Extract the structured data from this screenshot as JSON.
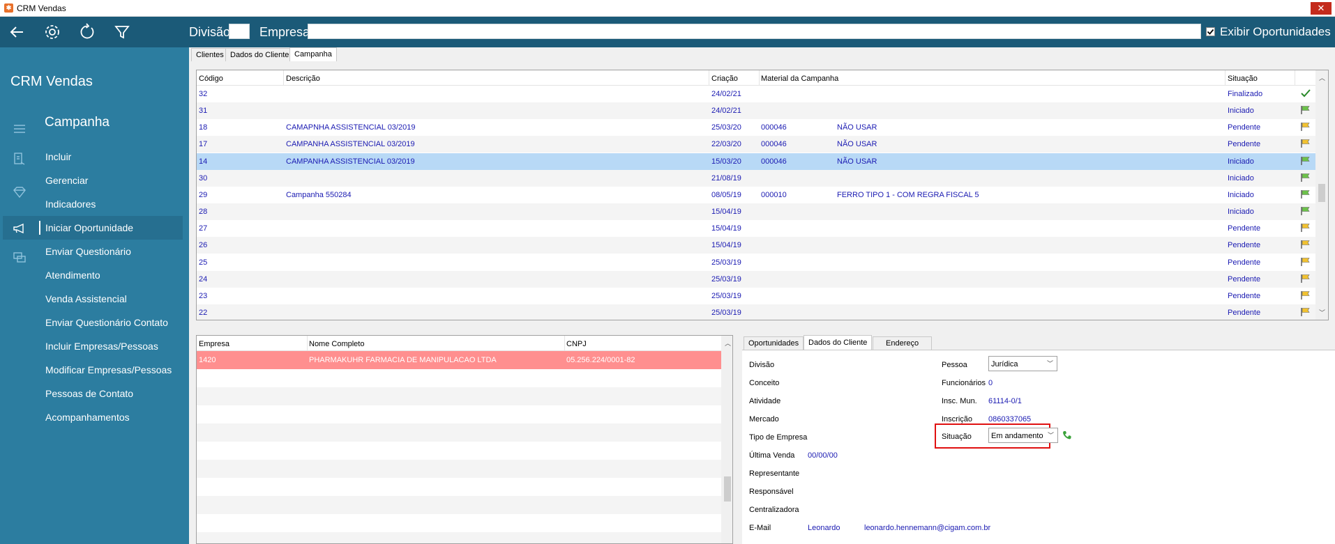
{
  "window": {
    "title": "CRM Vendas",
    "close_glyph": "✕"
  },
  "toolbar": {
    "division_label": "Divisão",
    "division_value": "",
    "company_label": "Empresa",
    "company_value": "",
    "show_opportunities_label": "Exibir Oportunidades",
    "show_opportunities_checked": true,
    "icons": [
      "back-arrow-icon",
      "gear-icon",
      "refresh-icon",
      "filter-icon"
    ]
  },
  "sidebar": {
    "app_title": "CRM Vendas",
    "section": "Campanha",
    "items": [
      {
        "label": "Incluir"
      },
      {
        "label": "Gerenciar"
      },
      {
        "label": "Indicadores"
      },
      {
        "label": "Iniciar Oportunidade",
        "selected": true
      },
      {
        "label": "Enviar Questionário"
      },
      {
        "label": "Atendimento"
      },
      {
        "label": "Venda Assistencial"
      },
      {
        "label": "Enviar Questionário Contato"
      },
      {
        "label": "Incluir Empresas/Pessoas"
      },
      {
        "label": "Modificar Empresas/Pessoas"
      },
      {
        "label": "Pessoas de Contato"
      },
      {
        "label": "Acompanhamentos"
      }
    ]
  },
  "top_tabs": [
    {
      "label": "Clientes",
      "active": false
    },
    {
      "label": "Dados do Cliente",
      "active": false
    },
    {
      "label": "Campanha",
      "active": true
    }
  ],
  "campaign_table": {
    "columns": [
      "Código",
      "Descrição",
      "Criação",
      "Material da Campanha",
      "Situação"
    ],
    "rows": [
      {
        "code": "32",
        "desc": "",
        "created": "24/02/21",
        "mat_code": "",
        "mat_desc": "",
        "status": "Finalizado",
        "icon": "check-icon"
      },
      {
        "code": "31",
        "desc": "",
        "created": "24/02/21",
        "mat_code": "",
        "mat_desc": "",
        "status": "Iniciado",
        "icon": "green-flag-icon"
      },
      {
        "code": "18",
        "desc": "CAMAPNHA ASSISTENCIAL 03/2019",
        "created": "25/03/20",
        "mat_code": "000046",
        "mat_desc": "NÃO USAR",
        "status": "Pendente",
        "icon": "yellow-flag-icon"
      },
      {
        "code": "17",
        "desc": "CAMPANHA ASSISTENCIAL 03/2019",
        "created": "22/03/20",
        "mat_code": "000046",
        "mat_desc": "NÃO USAR",
        "status": "Pendente",
        "icon": "yellow-flag-icon"
      },
      {
        "code": "14",
        "desc": "CAMPANHA ASSISTENCIAL 03/2019",
        "created": "15/03/20",
        "mat_code": "000046",
        "mat_desc": "NÃO USAR",
        "status": "Iniciado",
        "icon": "green-flag-icon",
        "selected": true
      },
      {
        "code": "30",
        "desc": "",
        "created": "21/08/19",
        "mat_code": "",
        "mat_desc": "",
        "status": "Iniciado",
        "icon": "green-flag-icon"
      },
      {
        "code": "29",
        "desc": "Campanha 550284",
        "created": "08/05/19",
        "mat_code": "000010",
        "mat_desc": "FERRO TIPO 1 - COM REGRA FISCAL 5",
        "status": "Iniciado",
        "icon": "green-flag-icon"
      },
      {
        "code": "28",
        "desc": "",
        "created": "15/04/19",
        "mat_code": "",
        "mat_desc": "",
        "status": "Iniciado",
        "icon": "green-flag-icon"
      },
      {
        "code": "27",
        "desc": "",
        "created": "15/04/19",
        "mat_code": "",
        "mat_desc": "",
        "status": "Pendente",
        "icon": "yellow-flag-icon"
      },
      {
        "code": "26",
        "desc": "",
        "created": "15/04/19",
        "mat_code": "",
        "mat_desc": "",
        "status": "Pendente",
        "icon": "yellow-flag-icon"
      },
      {
        "code": "25",
        "desc": "",
        "created": "25/03/19",
        "mat_code": "",
        "mat_desc": "",
        "status": "Pendente",
        "icon": "yellow-flag-icon"
      },
      {
        "code": "24",
        "desc": "",
        "created": "25/03/19",
        "mat_code": "",
        "mat_desc": "",
        "status": "Pendente",
        "icon": "yellow-flag-icon"
      },
      {
        "code": "23",
        "desc": "",
        "created": "25/03/19",
        "mat_code": "",
        "mat_desc": "",
        "status": "Pendente",
        "icon": "yellow-flag-icon"
      },
      {
        "code": "22",
        "desc": "",
        "created": "25/03/19",
        "mat_code": "",
        "mat_desc": "",
        "status": "Pendente",
        "icon": "yellow-flag-icon"
      }
    ]
  },
  "company_table": {
    "columns": [
      "Empresa",
      "Nome Completo",
      "CNPJ"
    ],
    "rows": [
      {
        "empresa": "1420",
        "nome": "PHARMAKUHR FARMACIA DE MANIPULACAO LTDA",
        "cnpj": "05.256.224/0001-82",
        "highlight": "#ff8f8f"
      }
    ]
  },
  "detail_tabs": [
    {
      "label": "Oportunidades",
      "active": false
    },
    {
      "label": "Dados do Cliente",
      "active": true
    },
    {
      "label": "Endereço",
      "active": false
    }
  ],
  "client_data": {
    "divisao_label": "Divisão",
    "conceito_label": "Conceito",
    "atividade_label": "Atividade",
    "mercado_label": "Mercado",
    "tipo_label": "Tipo de Empresa",
    "ultima_venda_label": "Última Venda",
    "ultima_venda": "00/00/00",
    "representante_label": "Representante",
    "responsavel_label": "Responsável",
    "centralizadora_label": "Centralizadora",
    "email_label": "E-Mail",
    "email_name": "Leonardo",
    "email_address": "leonardo.hennemann@cigam.com.br",
    "pessoa_label": "Pessoa",
    "pessoa": "Jurídica",
    "funcionarios_label": "Funcionários",
    "funcionarios": "0",
    "insc_mun_label": "Insc. Mun.",
    "insc_mun": "61114-0/1",
    "inscricao_label": "Inscrição",
    "inscricao": "0860337065",
    "situacao_label": "Situação",
    "situacao": "Em andamento"
  },
  "colors": {
    "toolbar": "#1b5a78",
    "sidebar": "#2c7da0",
    "selected_row": "#b8d9f6",
    "highlight_row": "#ff8f8f",
    "link_text": "#1a1ab2",
    "callout": "#e01010"
  }
}
